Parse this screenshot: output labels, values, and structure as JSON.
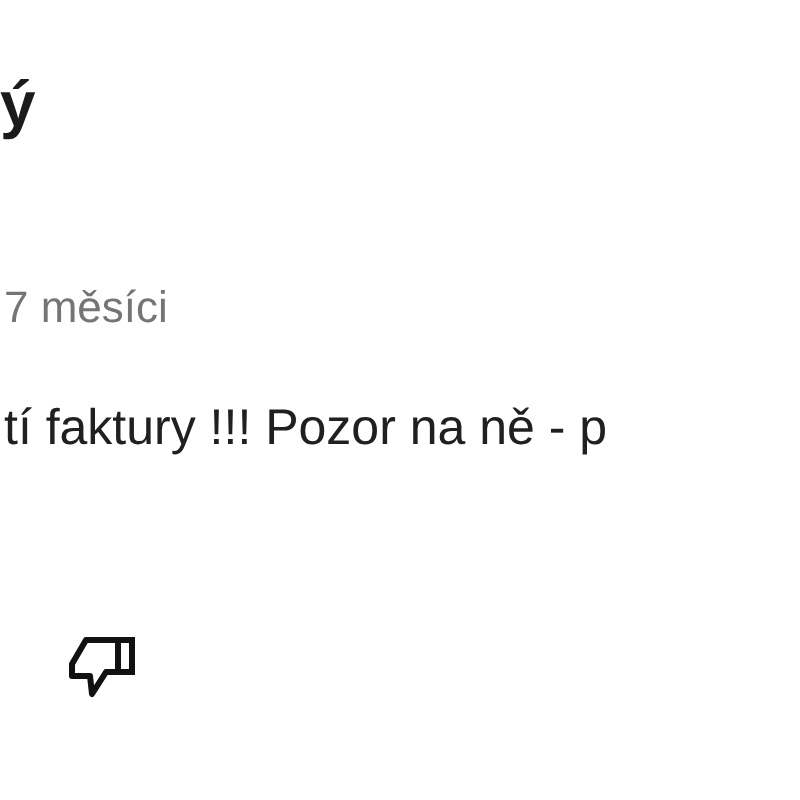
{
  "review": {
    "author": "ý",
    "date": "7 měsíci",
    "text": "tí faktury !!! Pozor na ně - p",
    "disliked": false
  }
}
